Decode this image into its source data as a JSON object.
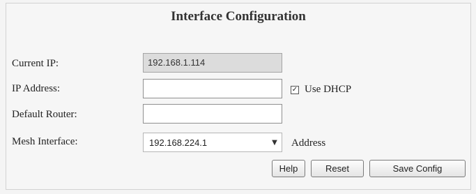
{
  "form": {
    "title": "Interface Configuration",
    "current_ip": {
      "label": "Current IP:",
      "value": "192.168.1.114"
    },
    "ip_address": {
      "label": "IP Address:",
      "value": ""
    },
    "use_dhcp": {
      "label": "Use DHCP",
      "checked": true,
      "check_glyph": "✓"
    },
    "default_router": {
      "label": "Default Router:",
      "value": ""
    },
    "mesh_interface": {
      "label": "Mesh Interface:",
      "selected": "192.168.224.1",
      "suffix": "Address",
      "arrow_glyph": "▼"
    },
    "buttons": {
      "help": "Help",
      "reset": "Reset",
      "save": "Save Config"
    }
  }
}
